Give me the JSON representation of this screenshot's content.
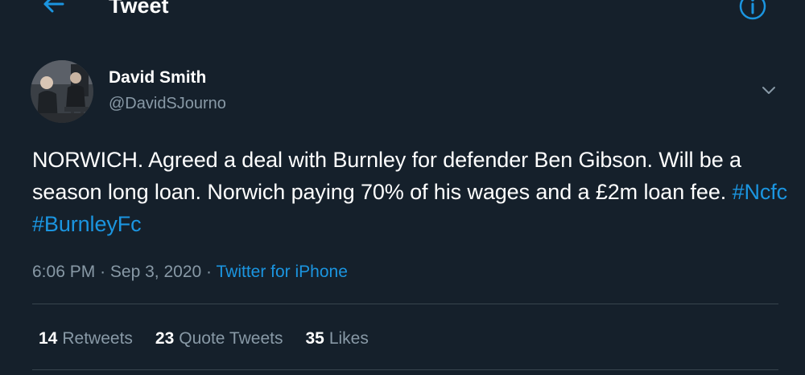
{
  "colors": {
    "background": "#15202b",
    "accent": "#1b95e0",
    "muted": "#8899a6",
    "divider": "#38444d"
  },
  "header": {
    "title": "Tweet",
    "back_icon": "arrow-left-icon",
    "info_icon": "info-icon"
  },
  "author": {
    "name": "David Smith",
    "handle": "@DavidSJourno",
    "avatar": "avatar-photo"
  },
  "tweet": {
    "text_before": "NORWICH. Agreed a deal with Burnley for defender Ben Gibson. Will be a season long loan. Norwich paying 70% of his wages and a £2m loan fee.",
    "hashtags": [
      "#Ncfc",
      "#BurnleyFc"
    ],
    "time": "6:06 PM",
    "date": "Sep 3, 2020",
    "separator": "·",
    "source": "Twitter for iPhone"
  },
  "stats": [
    {
      "count": "14",
      "label": "Retweets"
    },
    {
      "count": "23",
      "label": "Quote Tweets"
    },
    {
      "count": "35",
      "label": "Likes"
    }
  ]
}
